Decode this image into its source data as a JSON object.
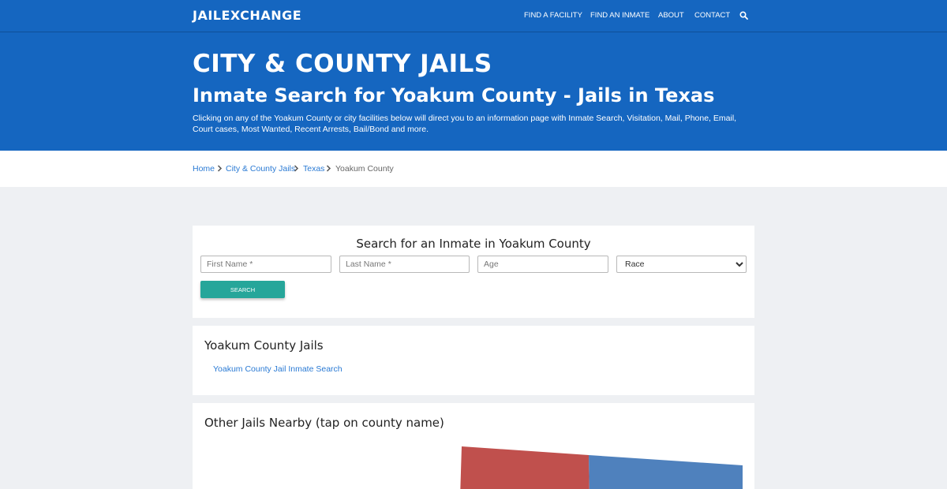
{
  "header": {
    "logo_text": "JAILEXCHANGE",
    "nav": [
      "FIND A FACILITY",
      "FIND AN INMATE",
      "ABOUT",
      "CONTACT"
    ],
    "search_icon": "search-icon"
  },
  "hero": {
    "title": "CITY & COUNTY JAILS",
    "subtitle": "Inmate Search for Yoakum County - Jails in Texas",
    "description": "Clicking on any of the Yoakum County or city facilities below will direct you to an information page with Inmate Search, Visitation, Mail, Phone, Email, Court cases, Most Wanted, Recent Arrests, Bail/Bond and more."
  },
  "breadcrumb": [
    "Home",
    "City & County Jails",
    "Texas",
    "Yoakum County"
  ],
  "search_form": {
    "title": "Search for an Inmate in Yoakum County",
    "first_name_placeholder": "First Name *",
    "last_name_placeholder": "Last Name *",
    "age_placeholder": "Age",
    "race_selected": "Race",
    "button_label": "SEARCH"
  },
  "jails": {
    "heading": "Yoakum County Jails",
    "links": [
      "Yoakum County Jail Inmate Search"
    ]
  },
  "nearby": {
    "heading": "Other Jails Nearby (tap on county name)",
    "map_colors": [
      "#c0504d",
      "#4f81bd"
    ]
  },
  "colors": {
    "brand_blue": "#1566c0",
    "link_blue": "#2a7ad4",
    "button_teal": "#26a69a",
    "page_bg": "#eef0f3"
  }
}
